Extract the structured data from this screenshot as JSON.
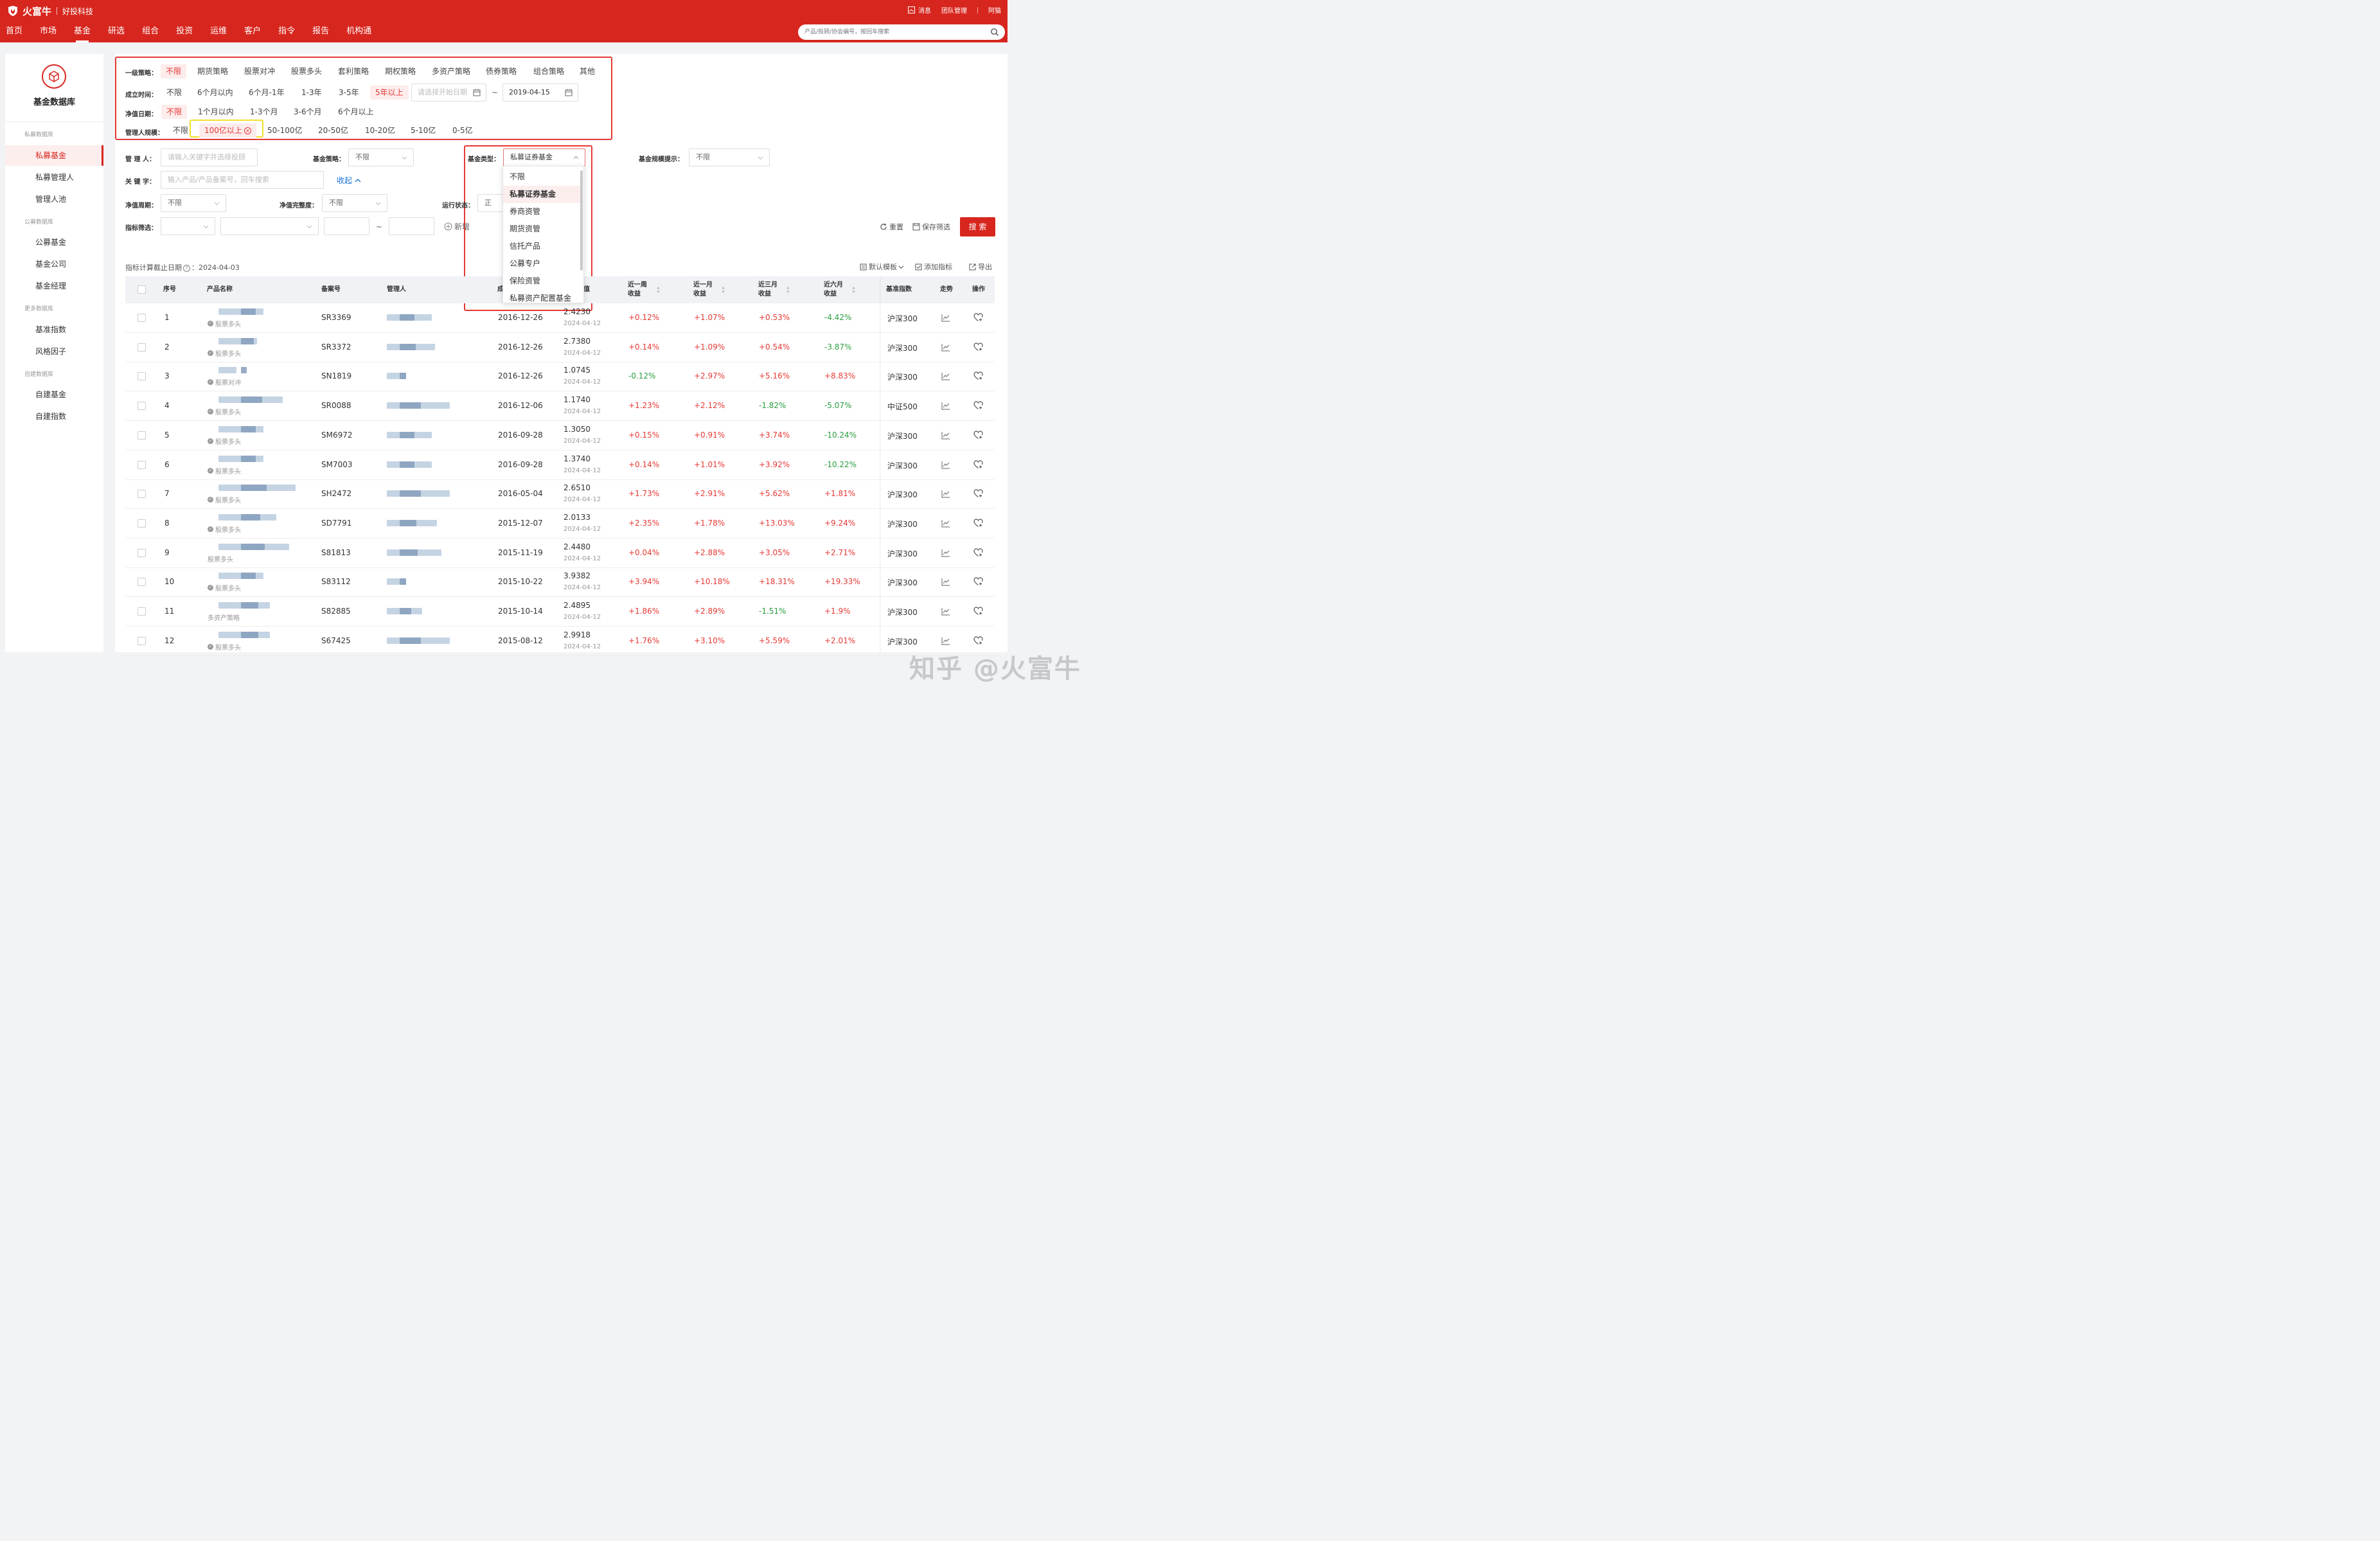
{
  "header": {
    "brand_name": "火富牛",
    "brand_sub": "好投科技",
    "messages": "消息",
    "team": "团队管理",
    "user": "阿猫",
    "nav": [
      "首页",
      "市场",
      "基金",
      "研选",
      "组合",
      "投资",
      "运维",
      "客户",
      "指令",
      "报告",
      "机构通"
    ],
    "nav_active": "基金",
    "search_placeholder": "产品/投顾/协会编号，按回车搜索"
  },
  "sidebar": {
    "title": "基金数据库",
    "groups": [
      {
        "label": "私募数据库",
        "items": [
          "私募基金",
          "私募管理人",
          "管理人池"
        ]
      },
      {
        "label": "公募数据库",
        "items": [
          "公募基金",
          "基金公司",
          "基金经理"
        ]
      },
      {
        "label": "更多数据库",
        "items": [
          "基准指数",
          "风格因子"
        ]
      },
      {
        "label": "自建数据库",
        "items": [
          "自建基金",
          "自建指数"
        ]
      }
    ],
    "active": "私募基金"
  },
  "filters": {
    "strategy": {
      "label": "一级策略：",
      "options": [
        "不限",
        "期货策略",
        "股票对冲",
        "股票多头",
        "套利策略",
        "期权策略",
        "多资产策略",
        "债券策略",
        "组合策略",
        "其他"
      ],
      "active": "不限"
    },
    "inception": {
      "label": "成立时间：",
      "options": [
        "不限",
        "6个月以内",
        "6个月-1年",
        "1-3年",
        "3-5年",
        "5年以上"
      ],
      "active": "5年以上",
      "start_placeholder": "请选择开始日期",
      "end_value": "2019-04-15",
      "tilde": "~"
    },
    "nav_date": {
      "label": "净值日期：",
      "options": [
        "不限",
        "1个月以内",
        "1-3个月",
        "3-6个月",
        "6个月以上"
      ],
      "active": "不限"
    },
    "manager_scale": {
      "label": "管理人规模：",
      "options": [
        "不限",
        "100亿以上",
        "50-100亿",
        "20-50亿",
        "10-20亿",
        "5-10亿",
        "0-5亿"
      ],
      "active": "100亿以上",
      "clear_glyph": "×"
    },
    "manager": {
      "label": "管 理 人：",
      "placeholder": "请输入关键字并选择投顾"
    },
    "fund_strategy": {
      "label": "基金策略：",
      "value": "不限"
    },
    "fund_type": {
      "label": "基金类型：",
      "value": "私募证券基金"
    },
    "scale_hint": {
      "label": "基金规模提示：",
      "value": "不限"
    },
    "keyword": {
      "label": "关 键 字：",
      "placeholder": "输入产品/产品备案号，回车搜索"
    },
    "collapse": "收起",
    "nav_period": {
      "label": "净值周期：",
      "value": "不限"
    },
    "nav_complete": {
      "label": "净值完整度：",
      "value": "不限"
    },
    "run_status": {
      "label": "运行状态：",
      "value": "正常运"
    },
    "indicator": {
      "label": "指标筛选：",
      "add": "新增",
      "tilde": "~"
    },
    "reset": "重置",
    "save": "保存筛选",
    "search": "搜 索"
  },
  "fund_type_dropdown": {
    "options": [
      "不限",
      "私募证券基金",
      "券商资管",
      "期货资管",
      "信托产品",
      "公募专户",
      "保险资管",
      "私募资产配置基金"
    ],
    "selected": "私募证券基金"
  },
  "toolbar": {
    "calc_date_label": "指标计算截止日期",
    "calc_date_value": "：2024-04-03",
    "help_glyph": "?",
    "template": "默认模板",
    "add_indicator": "添加指标",
    "export": "导出"
  },
  "table": {
    "headers": {
      "index": "序号",
      "name": "产品名称",
      "record": "备案号",
      "manager": "管理人",
      "inception": "成",
      "nav": "值",
      "w1": [
        "近一周",
        "收益"
      ],
      "m1": [
        "近一月",
        "收益"
      ],
      "m3": [
        "近三月",
        "收益"
      ],
      "m6": [
        "近六月",
        "收益"
      ],
      "bench": "基准指数",
      "trend": "走势",
      "op": "操作"
    },
    "rows": [
      {
        "idx": "1",
        "tag": "股票多头",
        "tag_check": true,
        "record": "SR3369",
        "inception": "2016-12-26",
        "nav": "2.4230",
        "nav_date": "2024-04-12",
        "w1": "+0.12%",
        "m1": "+1.07%",
        "m3": "+0.53%",
        "m6": "-4.42%",
        "bench": "沪深300"
      },
      {
        "idx": "2",
        "tag": "股票多头",
        "tag_check": true,
        "record": "SR3372",
        "inception": "2016-12-26",
        "nav": "2.7380",
        "nav_date": "2024-04-12",
        "w1": "+0.14%",
        "m1": "+1.09%",
        "m3": "+0.54%",
        "m6": "-3.87%",
        "bench": "沪深300"
      },
      {
        "idx": "3",
        "tag": "股票对冲",
        "tag_check": true,
        "record": "SN1819",
        "inception": "2016-12-26",
        "nav": "1.0745",
        "nav_date": "2024-04-12",
        "w1": "-0.12%",
        "m1": "+2.97%",
        "m3": "+5.16%",
        "m6": "+8.83%",
        "bench": "沪深300"
      },
      {
        "idx": "4",
        "tag": "股票多头",
        "tag_check": true,
        "record": "SR0088",
        "inception": "2016-12-06",
        "nav": "1.1740",
        "nav_date": "2024-04-12",
        "w1": "+1.23%",
        "m1": "+2.12%",
        "m3": "-1.82%",
        "m6": "-5.07%",
        "bench": "中证500"
      },
      {
        "idx": "5",
        "tag": "股票多头",
        "tag_check": true,
        "record": "SM6972",
        "inception": "2016-09-28",
        "nav": "1.3050",
        "nav_date": "2024-04-12",
        "w1": "+0.15%",
        "m1": "+0.91%",
        "m3": "+3.74%",
        "m6": "-10.24%",
        "bench": "沪深300"
      },
      {
        "idx": "6",
        "tag": "股票多头",
        "tag_check": true,
        "record": "SM7003",
        "inception": "2016-09-28",
        "nav": "1.3740",
        "nav_date": "2024-04-12",
        "w1": "+0.14%",
        "m1": "+1.01%",
        "m3": "+3.92%",
        "m6": "-10.22%",
        "bench": "沪深300"
      },
      {
        "idx": "7",
        "tag": "股票多头",
        "tag_check": true,
        "record": "SH2472",
        "inception": "2016-05-04",
        "nav": "2.6510",
        "nav_date": "2024-04-12",
        "w1": "+1.73%",
        "m1": "+2.91%",
        "m3": "+5.62%",
        "m6": "+1.81%",
        "bench": "沪深300"
      },
      {
        "idx": "8",
        "tag": "股票多头",
        "tag_check": true,
        "record": "SD7791",
        "inception": "2015-12-07",
        "nav": "2.0133",
        "nav_date": "2024-04-12",
        "w1": "+2.35%",
        "m1": "+1.78%",
        "m3": "+13.03%",
        "m6": "+9.24%",
        "bench": "沪深300"
      },
      {
        "idx": "9",
        "tag": "股票多头",
        "tag_check": false,
        "record": "S81813",
        "inception": "2015-11-19",
        "nav": "2.4480",
        "nav_date": "2024-04-12",
        "w1": "+0.04%",
        "m1": "+2.88%",
        "m3": "+3.05%",
        "m6": "+2.71%",
        "bench": "沪深300"
      },
      {
        "idx": "10",
        "tag": "股票多头",
        "tag_check": true,
        "record": "S83112",
        "inception": "2015-10-22",
        "nav": "3.9382",
        "nav_date": "2024-04-12",
        "w1": "+3.94%",
        "m1": "+10.18%",
        "m3": "+18.31%",
        "m6": "+19.33%",
        "bench": "沪深300"
      },
      {
        "idx": "11",
        "tag": "多资产策略",
        "tag_check": false,
        "record": "S82885",
        "inception": "2015-10-14",
        "nav": "2.4895",
        "nav_date": "2024-04-12",
        "w1": "+1.86%",
        "m1": "+2.89%",
        "m3": "-1.51%",
        "m6": "+1.9%",
        "bench": "沪深300"
      },
      {
        "idx": "12",
        "tag": "股票多头",
        "tag_check": true,
        "record": "S67425",
        "inception": "2015-08-12",
        "nav": "2.9918",
        "nav_date": "2024-04-12",
        "w1": "+1.76%",
        "m1": "+3.10%",
        "m3": "+5.59%",
        "m6": "+2.01%",
        "bench": "沪深300"
      }
    ]
  },
  "watermark": "知乎 @火富牛",
  "colors": {
    "brand_red": "#d7261e",
    "positive": "#e53935",
    "negative": "#2a9d3f",
    "highlight_box": "#f2df2a",
    "link_blue": "#1a73d9"
  }
}
